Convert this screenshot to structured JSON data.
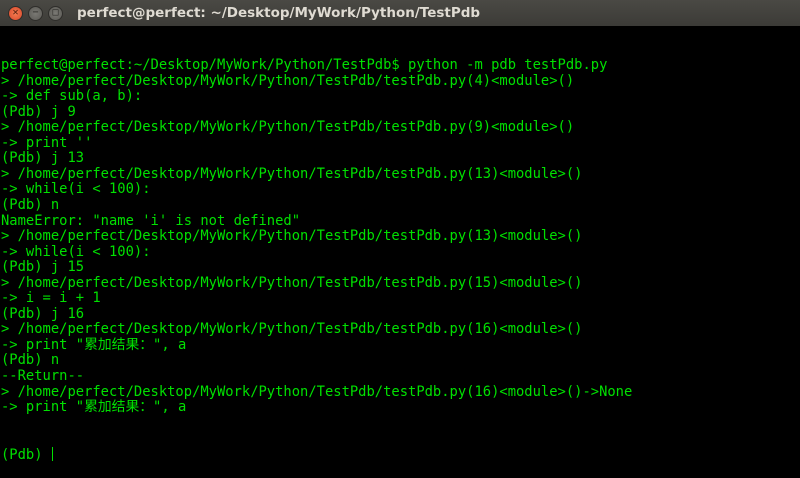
{
  "window": {
    "title": "perfect@perfect: ~/Desktop/MyWork/Python/TestPdb"
  },
  "terminal": {
    "lines": [
      "perfect@perfect:~/Desktop/MyWork/Python/TestPdb$ python -m pdb testPdb.py",
      "> /home/perfect/Desktop/MyWork/Python/TestPdb/testPdb.py(4)<module>()",
      "-> def sub(a, b):",
      "(Pdb) j 9",
      "> /home/perfect/Desktop/MyWork/Python/TestPdb/testPdb.py(9)<module>()",
      "-> print ''",
      "(Pdb) j 13",
      "> /home/perfect/Desktop/MyWork/Python/TestPdb/testPdb.py(13)<module>()",
      "-> while(i < 100):",
      "(Pdb) n",
      "NameError: \"name 'i' is not defined\"",
      "> /home/perfect/Desktop/MyWork/Python/TestPdb/testPdb.py(13)<module>()",
      "-> while(i < 100):",
      "(Pdb) j 15",
      "> /home/perfect/Desktop/MyWork/Python/TestPdb/testPdb.py(15)<module>()",
      "-> i = i + 1",
      "(Pdb) j 16",
      "> /home/perfect/Desktop/MyWork/Python/TestPdb/testPdb.py(16)<module>()",
      "-> print \"累加结果：\", a",
      "(Pdb) n",
      "--Return--",
      "> /home/perfect/Desktop/MyWork/Python/TestPdb/testPdb.py(16)<module>()->None",
      "-> print \"累加结果：\", a"
    ],
    "prompt": "(Pdb) "
  },
  "colors": {
    "text": "#00e000",
    "background": "#000000",
    "titlebar": "#3c3b37"
  }
}
